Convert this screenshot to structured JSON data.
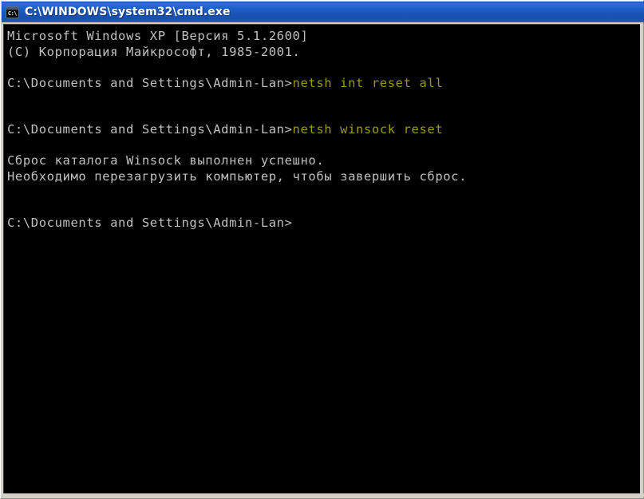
{
  "window": {
    "title": "C:\\WINDOWS\\system32\\cmd.exe",
    "icon_name": "cmd-prompt-icon",
    "icon_glyph": "C:\\",
    "title_bar_color": "#1a55b8",
    "background_color": "#000000",
    "text_color": "#c0c0c0",
    "typed_command_color": "#9a9a00"
  },
  "console": {
    "lines": [
      {
        "id": "banner-version",
        "text": "Microsoft Windows XP [Версия 5.1.2600]",
        "type": "output"
      },
      {
        "id": "banner-copyright",
        "text": "(C) Корпорация Майкрософт, 1985-2001.",
        "type": "output"
      },
      {
        "id": "blank-1",
        "text": "",
        "type": "blank"
      },
      {
        "id": "prompt-1",
        "prompt": "C:\\Documents and Settings\\Admin-Lan>",
        "command": "netsh int reset all",
        "type": "prompt"
      },
      {
        "id": "blank-2",
        "text": "",
        "type": "blank"
      },
      {
        "id": "blank-3",
        "text": "",
        "type": "blank"
      },
      {
        "id": "prompt-2",
        "prompt": "C:\\Documents and Settings\\Admin-Lan>",
        "command": "netsh winsock reset",
        "type": "prompt"
      },
      {
        "id": "blank-4",
        "text": "",
        "type": "blank"
      },
      {
        "id": "output-1",
        "text": "Сброс каталога Winsock выполнен успешно.",
        "type": "output"
      },
      {
        "id": "output-2",
        "text": "Необходимо перезагрузить компьютер, чтобы завершить сброс.",
        "type": "output"
      },
      {
        "id": "blank-5",
        "text": "",
        "type": "blank"
      },
      {
        "id": "blank-6",
        "text": "",
        "type": "blank"
      },
      {
        "id": "prompt-3",
        "prompt": "C:\\Documents and Settings\\Admin-Lan>",
        "command": "",
        "type": "prompt"
      }
    ]
  }
}
